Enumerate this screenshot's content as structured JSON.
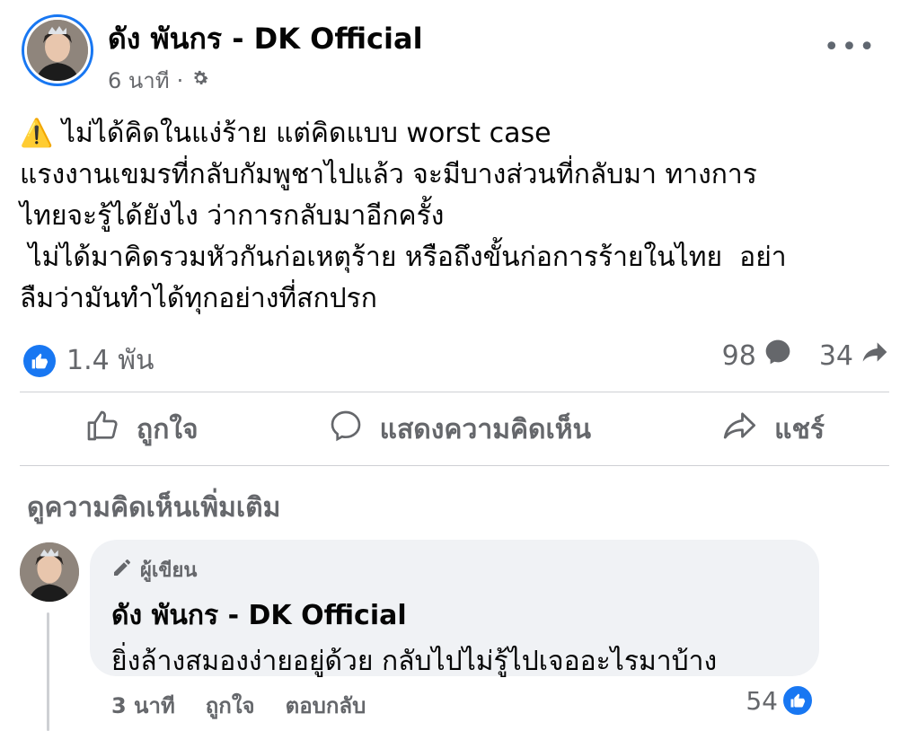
{
  "post": {
    "author": "ดัง พันกร - DK Official",
    "time": "6 นาที",
    "separator": "·",
    "warning_emoji": "⚠️",
    "text_lines": [
      " ไม่ได้คิดในแง่ร้าย แต่คิดแบบ worst case",
      "แรงงานเขมรที่กลับกัมพูชาไปแล้ว จะมีบางส่วนที่กลับมา ทางการ",
      "ไทยจะรู้ได้ยังไง ว่าการกลับมาอีกครั้ง",
      " ไม่ได้มาคิดรวมหัวกันก่อเหตุร้าย หรือถึงขั้นก่อการร้ายในไทย  อย่า",
      "ลืมว่ามันทำได้ทุกอย่างที่สกปรก"
    ],
    "reaction_count": "1.4 พัน",
    "comment_count": "98",
    "share_count": "34",
    "more_menu": "•••"
  },
  "actions": {
    "like": "ถูกใจ",
    "comment": "แสดงความคิดเห็น",
    "share": "แชร์"
  },
  "more_comments": "ดูความคิดเห็นเพิ่มเติม",
  "comment": {
    "badge": "ผู้เขียน",
    "author": "ดัง พันกร - DK Official",
    "text": "ยิ่งล้างสมองง่ายอยู่ด้วย กลับไปไม่รู้ไปเจออะไรมาบ้าง",
    "time": "3 นาที",
    "like": "ถูกใจ",
    "reply": "ตอบกลับ",
    "reaction_count": "54"
  },
  "colors": {
    "accent": "#1877f2",
    "secondary_text": "#65676b",
    "bubble": "#f0f2f5"
  }
}
